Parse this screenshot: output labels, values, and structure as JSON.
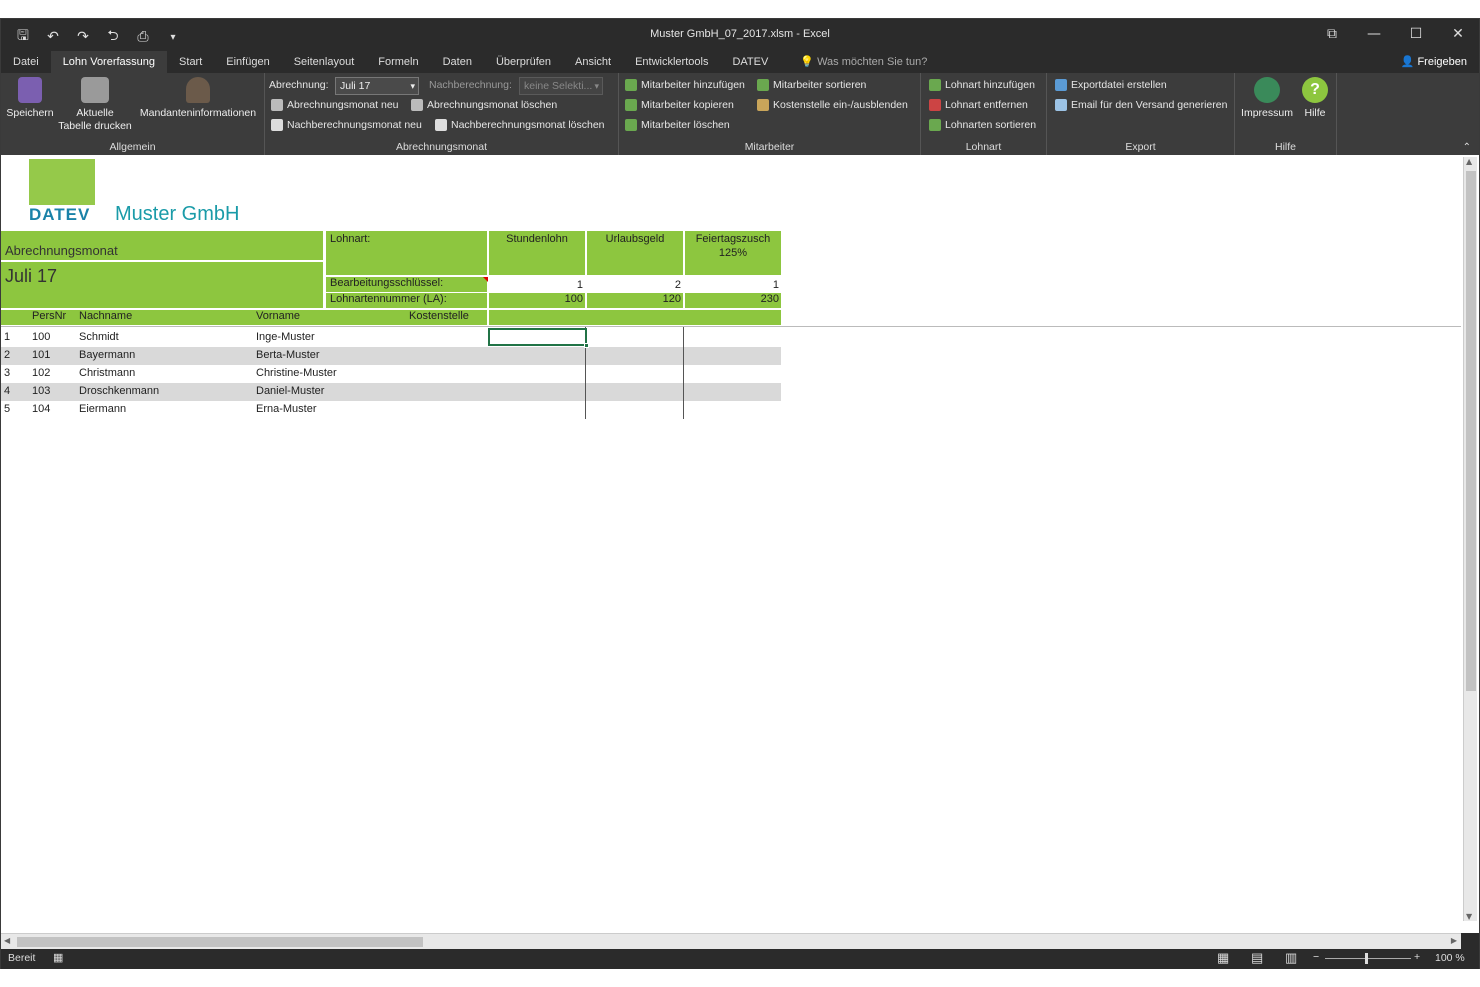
{
  "window": {
    "title": "Muster GmbH_07_2017.xlsm - Excel"
  },
  "qat": {
    "icons": [
      "save-icon",
      "undo-icon",
      "redo-icon",
      "touch-mode-icon",
      "print-preview-icon",
      "customize-icon"
    ]
  },
  "tabs": [
    {
      "label": "Datei",
      "active": false
    },
    {
      "label": "Lohn Vorerfassung",
      "active": true
    },
    {
      "label": "Start",
      "active": false
    },
    {
      "label": "Einfügen",
      "active": false
    },
    {
      "label": "Seitenlayout",
      "active": false
    },
    {
      "label": "Formeln",
      "active": false
    },
    {
      "label": "Daten",
      "active": false
    },
    {
      "label": "Überprüfen",
      "active": false
    },
    {
      "label": "Ansicht",
      "active": false
    },
    {
      "label": "Entwicklertools",
      "active": false
    },
    {
      "label": "DATEV",
      "active": false
    }
  ],
  "tell_me": "Was möchten Sie tun?",
  "share": "Freigeben",
  "ribbon": {
    "allgemein": {
      "label": "Allgemein",
      "save": "Speichern",
      "print_line1": "Aktuelle",
      "print_line2": "Tabelle drucken",
      "client": "Mandanteninformationen"
    },
    "abrechnungsmonat": {
      "label": "Abrechnungsmonat",
      "abrechnung_label": "Abrechnung:",
      "abrechnung_value": "Juli 17",
      "nachberechnung_label": "Nachberechnung:",
      "nachberechnung_value": "keine Selekti...",
      "new_month": "Abrechnungsmonat neu",
      "delete_month": "Abrechnungsmonat löschen",
      "new_recalc": "Nachberechnungsmonat neu",
      "delete_recalc": "Nachberechnungsmonat löschen"
    },
    "mitarbeiter": {
      "label": "Mitarbeiter",
      "add": "Mitarbeiter hinzufügen",
      "sort": "Mitarbeiter sortieren",
      "copy": "Mitarbeiter kopieren",
      "cost_center": "Kostenstelle ein-/ausblenden",
      "delete": "Mitarbeiter löschen"
    },
    "lohnart": {
      "label": "Lohnart",
      "add": "Lohnart hinzufügen",
      "remove": "Lohnart entfernen",
      "sort": "Lohnarten sortieren"
    },
    "export": {
      "label": "Export",
      "create": "Exportdatei erstellen",
      "email": "Email für den Versand generieren"
    },
    "hilfe": {
      "label": "Hilfe",
      "impressum": "Impressum",
      "help": "Hilfe"
    }
  },
  "sheet": {
    "logo_text": "DATEV",
    "company": "Muster GmbH",
    "month_label": "Abrechnungsmonat",
    "month_value": "Juli 17",
    "lohnart_label": "Lohnart:",
    "key_label": "Bearbeitungsschlüssel:",
    "la_label": "Lohnartennummer (LA):",
    "wage_types": [
      {
        "name": "Stundenlohn",
        "sub": "",
        "key": "1",
        "la": "100"
      },
      {
        "name": "Urlaubsgeld",
        "sub": "",
        "key": "2",
        "la": "120"
      },
      {
        "name": "Feiertagszusch",
        "sub": "125%",
        "key": "1",
        "la": "230"
      }
    ],
    "headers": {
      "persnr": "PersNr",
      "nachname": "Nachname",
      "vorname": "Vorname",
      "kostenstelle": "Kostenstelle"
    },
    "rows": [
      {
        "n": "1",
        "persnr": "100",
        "nachname": "Schmidt",
        "vorname": "Inge-Muster"
      },
      {
        "n": "2",
        "persnr": "101",
        "nachname": "Bayermann",
        "vorname": "Berta-Muster"
      },
      {
        "n": "3",
        "persnr": "102",
        "nachname": "Christmann",
        "vorname": "Christine-Muster"
      },
      {
        "n": "4",
        "persnr": "103",
        "nachname": "Droschkenmann",
        "vorname": "Daniel-Muster"
      },
      {
        "n": "5",
        "persnr": "104",
        "nachname": "Eiermann",
        "vorname": "Erna-Muster"
      }
    ]
  },
  "status": {
    "ready": "Bereit",
    "zoom": "100 %"
  },
  "colors": {
    "accent_green": "#8dc63f",
    "datev_blue": "#1a82a8",
    "ribbon_bg": "#3c3c3c",
    "title_bg": "#2b2b2b"
  }
}
